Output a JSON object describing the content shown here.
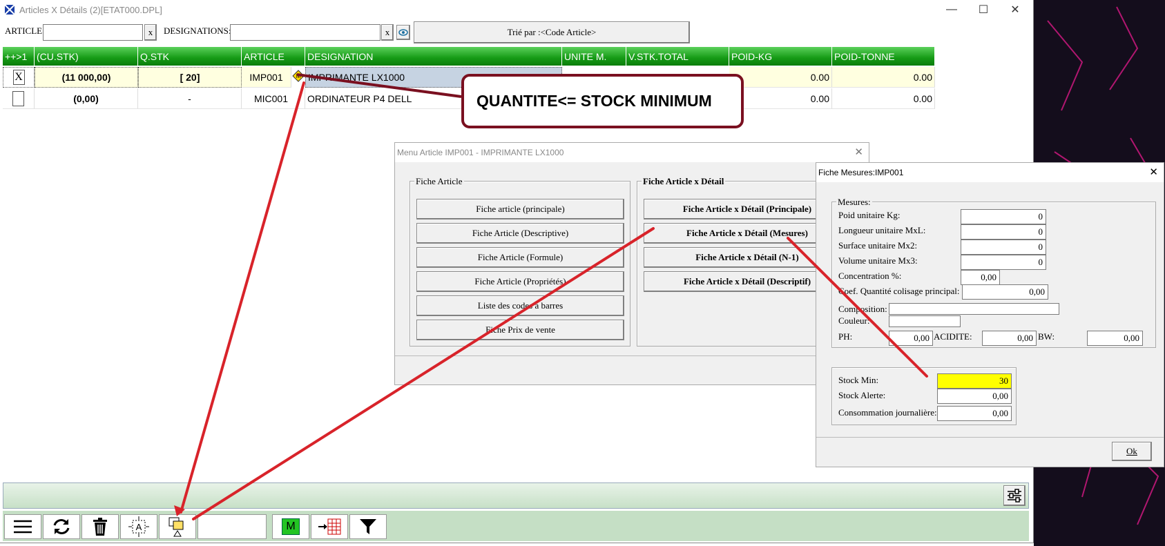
{
  "window": {
    "title": "Articles X Détails (2)[ETAT000.DPL]",
    "min": "—",
    "max": "☐",
    "close": "✕"
  },
  "filter": {
    "article_label": "ARTICLE:",
    "designations_label": "DESIGNATIONS:",
    "clear": "x",
    "sort_button": "Trié par :<Code Article>"
  },
  "grid": {
    "headers": [
      "++>1",
      "(CU.STK)",
      "Q.STK",
      "ARTICLE",
      "DESIGNATION",
      "UNITE M.",
      "V.STK.TOTAL",
      "POID-KG",
      "POID-TONNE"
    ],
    "rows": [
      {
        "check": "X",
        "cu_stk": "(11 000,00)",
        "q_stk": "[ 20]",
        "article": "IMP001",
        "designation": "IMPRIMANTE LX1000",
        "poid_kg": "0.00",
        "poid_tonne": "0.00"
      },
      {
        "check": "",
        "cu_stk": "(0,00)",
        "q_stk": "-",
        "article": "MIC001",
        "designation": "ORDINATEUR P4 DELL",
        "poid_kg": "0.00",
        "poid_tonne": "0.00"
      }
    ]
  },
  "callout": {
    "text": "QUANTITE<= STOCK MINIMUM"
  },
  "menu_dialog": {
    "title": "Menu Article IMP001 - IMPRIMANTE LX1000",
    "group1": {
      "title": "Fiche Article",
      "buttons": [
        "Fiche article (principale)",
        "Fiche Article (Descriptive)",
        "Fiche Article (Formule)",
        "Fiche Article (Propriétés)",
        "Liste des codes à barres",
        "Fiche Prix de vente"
      ]
    },
    "group2": {
      "title": "Fiche Article x Détail",
      "buttons": [
        "Fiche Article x Détail (Principale)",
        "Fiche Article x Détail (Mesures)",
        "Fiche Article x Détail (N-1)",
        "Fiche Article x Détail (Descriptif)"
      ]
    }
  },
  "mesures_dialog": {
    "title": "Fiche Mesures:IMP001",
    "group_title": "Mesures:",
    "fields": [
      {
        "label": "Poid unitaire Kg:",
        "value": "0"
      },
      {
        "label": "Longueur unitaire MxL:",
        "value": "0"
      },
      {
        "label": "Surface unitaire Mx2:",
        "value": "0"
      },
      {
        "label": "Volume unitaire Mx3:",
        "value": "0"
      }
    ],
    "concentration": {
      "label": "Concentration %:",
      "value": "0,00"
    },
    "coef": {
      "label": "Coef. Quantité colisage principal:",
      "value": "0,00"
    },
    "composition": {
      "label": "Composition:",
      "value": ""
    },
    "couleur": {
      "label": "Couleur:",
      "value": ""
    },
    "ph": {
      "label": "PH:",
      "value": "0,00"
    },
    "acidite": {
      "label": "ACIDITE:",
      "value": "0,00"
    },
    "bw": {
      "label": "BW:",
      "value": "0,00"
    },
    "stock_min": {
      "label": "Stock Min:",
      "value": "30"
    },
    "stock_alerte": {
      "label": "Stock Alerte:",
      "value": "0,00"
    },
    "conso": {
      "label": "Consommation journalière:",
      "value": "0,00"
    },
    "ok": "Ok"
  },
  "toolbar": {
    "m_label": "M"
  },
  "colors": {
    "accent_green": "#159a15",
    "callout_border": "#7a1020",
    "arrow": "#d8232a",
    "stock_min_bg": "#ffff00"
  }
}
